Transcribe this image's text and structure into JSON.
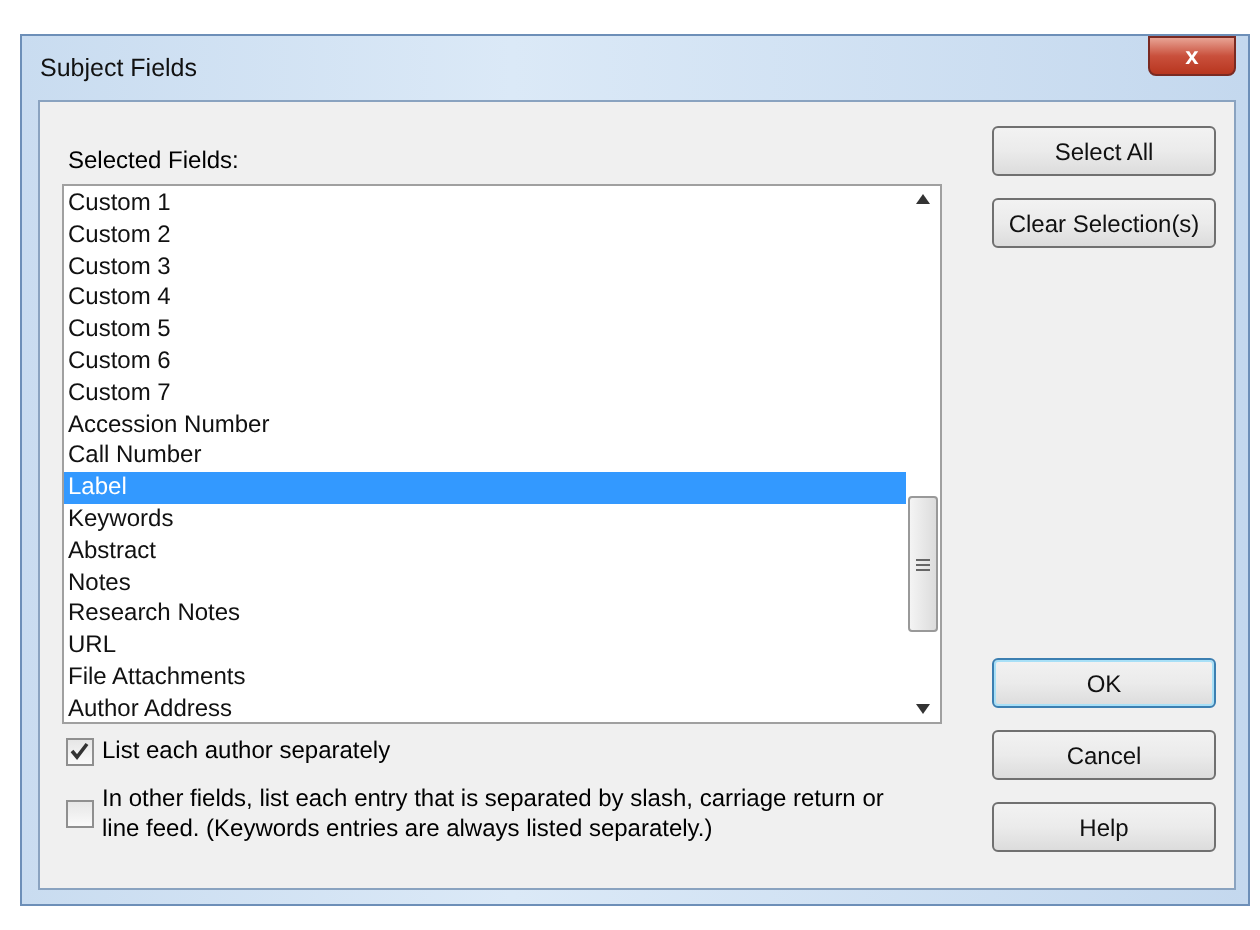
{
  "window": {
    "title": "Subject Fields",
    "close": "x"
  },
  "list_label": "Selected Fields:",
  "fields": [
    {
      "label": "Custom 1",
      "selected": false
    },
    {
      "label": "Custom 2",
      "selected": false
    },
    {
      "label": "Custom 3",
      "selected": false
    },
    {
      "label": "Custom 4",
      "selected": false
    },
    {
      "label": "Custom 5",
      "selected": false
    },
    {
      "label": "Custom 6",
      "selected": false
    },
    {
      "label": "Custom 7",
      "selected": false
    },
    {
      "label": "Accession Number",
      "selected": false
    },
    {
      "label": "Call Number",
      "selected": false
    },
    {
      "label": "Label",
      "selected": true
    },
    {
      "label": "Keywords",
      "selected": false
    },
    {
      "label": "Abstract",
      "selected": false
    },
    {
      "label": "Notes",
      "selected": false
    },
    {
      "label": "Research Notes",
      "selected": false
    },
    {
      "label": "URL",
      "selected": false
    },
    {
      "label": "File Attachments",
      "selected": false
    },
    {
      "label": "Author Address",
      "selected": false
    }
  ],
  "options": [
    {
      "label": "List each author separately",
      "checked": true
    },
    {
      "label": "In other fields, list each entry that is separated by slash, carriage return or line feed. (Keywords entries are always listed separately.)",
      "checked": false
    }
  ],
  "top_buttons": [
    "Select All",
    "Clear Selection(s)"
  ],
  "bottom_buttons": [
    {
      "label": "OK",
      "default": true
    },
    {
      "label": "Cancel",
      "default": false
    },
    {
      "label": "Help",
      "default": false
    }
  ]
}
